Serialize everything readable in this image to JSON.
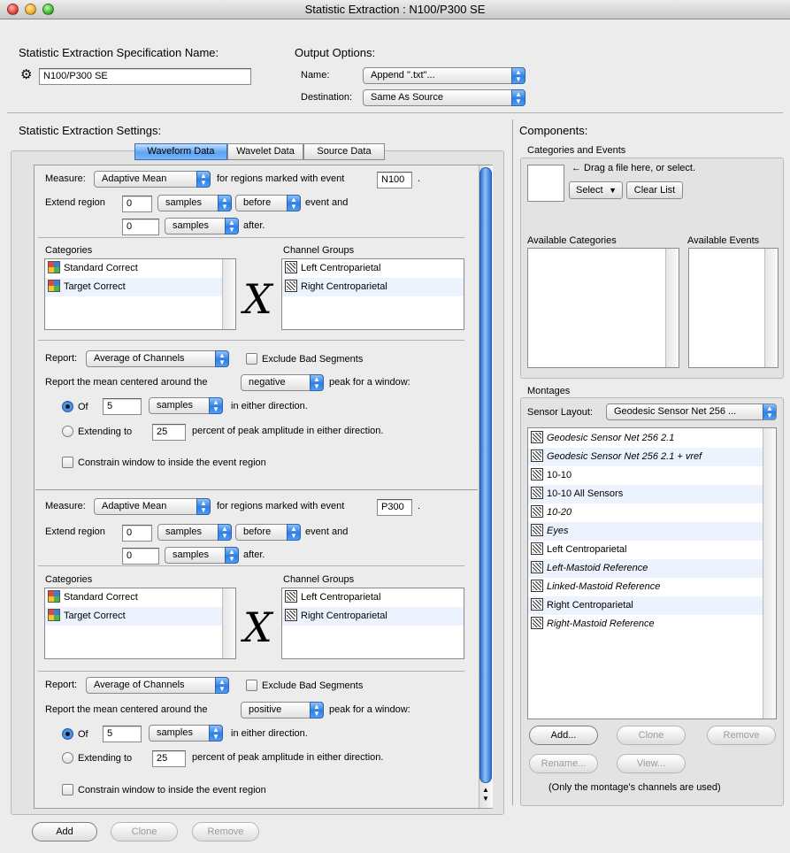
{
  "window": {
    "title": "Statistic Extraction : N100/P300 SE"
  },
  "spec": {
    "heading": "Statistic Extraction Specification Name:",
    "name_value": "N100/P300 SE"
  },
  "output": {
    "heading": "Output Options:",
    "name_label": "Name:",
    "name_value": "Append \".txt\"...",
    "destination_label": "Destination:",
    "destination_value": "Same As Source"
  },
  "settings": {
    "heading": "Statistic Extraction Settings:",
    "tabs": [
      "Waveform Data",
      "Wavelet Data",
      "Source Data"
    ],
    "blocks": [
      {
        "measure_label": "Measure:",
        "measure_value": "Adaptive Mean",
        "for_regions_text": "for regions marked with event",
        "event_value": "N100",
        "period": ".",
        "extend_label": "Extend region",
        "before_amount": "0",
        "before_unit": "samples",
        "before_dir": "before",
        "event_and": "event and",
        "after_amount": "0",
        "after_unit": "samples",
        "after_text": "after.",
        "categories_header": "Categories",
        "categories": [
          "Standard Correct",
          "Target Correct"
        ],
        "channel_groups_header": "Channel Groups",
        "channel_groups": [
          "Left Centroparietal",
          "Right Centroparietal"
        ],
        "x_symbol": "X",
        "report_label": "Report:",
        "report_value": "Average of Channels",
        "exclude_label": "Exclude Bad Segments",
        "mean_text": "Report the mean centered around the",
        "peak_value": "negative",
        "peak_window_text": "peak for a window:",
        "of_label": "Of",
        "of_value": "5",
        "of_unit": "samples",
        "either_dir": "in either direction.",
        "extending_label": "Extending to",
        "extending_value": "25",
        "percent_text": "percent of peak amplitude in either direction.",
        "constrain_label": "Constrain window to inside the event region"
      },
      {
        "measure_label": "Measure:",
        "measure_value": "Adaptive Mean",
        "for_regions_text": "for regions marked with event",
        "event_value": "P300",
        "period": ".",
        "extend_label": "Extend region",
        "before_amount": "0",
        "before_unit": "samples",
        "before_dir": "before",
        "event_and": "event and",
        "after_amount": "0",
        "after_unit": "samples",
        "after_text": "after.",
        "categories_header": "Categories",
        "categories": [
          "Standard Correct",
          "Target Correct"
        ],
        "channel_groups_header": "Channel Groups",
        "channel_groups": [
          "Left Centroparietal",
          "Right Centroparietal"
        ],
        "x_symbol": "X",
        "report_label": "Report:",
        "report_value": "Average of Channels",
        "exclude_label": "Exclude Bad Segments",
        "mean_text": "Report the mean centered around the",
        "peak_value": "positive",
        "peak_window_text": "peak for a window:",
        "of_label": "Of",
        "of_value": "5",
        "of_unit": "samples",
        "either_dir": "in either direction.",
        "extending_label": "Extending to",
        "extending_value": "25",
        "percent_text": "percent of peak amplitude in either direction.",
        "constrain_label": "Constrain window to inside the event region"
      }
    ],
    "buttons": {
      "add": "Add",
      "clone": "Clone",
      "remove": "Remove"
    }
  },
  "components": {
    "heading": "Components:",
    "cat_events_heading": "Categories and Events",
    "drag_hint": "← Drag a file here, or select.",
    "select_label": "Select",
    "clear_list_label": "Clear List",
    "available_categories": "Available Categories",
    "available_events": "Available Events"
  },
  "montages": {
    "heading": "Montages",
    "sensor_layout_label": "Sensor Layout:",
    "sensor_layout_value": "Geodesic Sensor Net 256 ...",
    "items": [
      "Geodesic Sensor Net 256 2.1",
      "Geodesic Sensor Net 256 2.1 + vref",
      "10-10",
      "10-10 All Sensors",
      "10-20",
      "Eyes",
      "Left Centroparietal",
      "Left-Mastoid Reference",
      "Linked-Mastoid Reference",
      "Right Centroparietal",
      "Right-Mastoid Reference"
    ],
    "buttons": {
      "add": "Add...",
      "clone": "Clone",
      "remove": "Remove",
      "rename": "Rename...",
      "view": "View..."
    },
    "note": "(Only the montage's channels are used)"
  }
}
